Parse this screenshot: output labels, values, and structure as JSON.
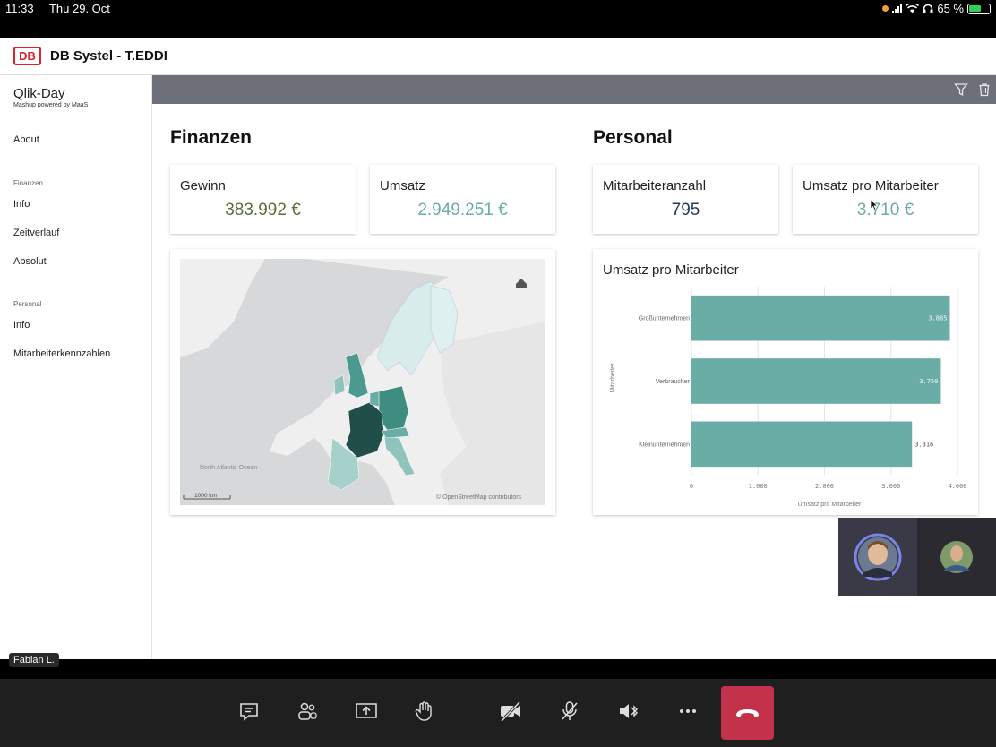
{
  "status_bar": {
    "time": "11:33",
    "date": "Thu 29. Oct",
    "battery": "65 %"
  },
  "header": {
    "logo": "DB",
    "title": "DB Systel - T.EDDI"
  },
  "sidebar": {
    "title": "Qlik-Day",
    "subtitle": "Mashup powered by MaaS",
    "about": "About",
    "sections": [
      {
        "label": "Finanzen",
        "items": [
          "Info",
          "Zeitverlauf",
          "Absolut"
        ]
      },
      {
        "label": "Personal",
        "items": [
          "Info",
          "Mitarbeiterkennzahlen"
        ]
      }
    ]
  },
  "finanzen": {
    "title": "Finanzen",
    "kpis": [
      {
        "label": "Gewinn",
        "value": "383.992 €",
        "color": "#5b6e3a"
      },
      {
        "label": "Umsatz",
        "value": "2.949.251 €",
        "color": "#6aada6"
      }
    ],
    "map": {
      "scale": "1000 km",
      "ocean": "North Atlantic Ocean",
      "attribution": "© OpenStreetMap contributors"
    }
  },
  "personal": {
    "title": "Personal",
    "kpis": [
      {
        "label": "Mitarbeiteranzahl",
        "value": "795",
        "color": "#1f3a5a"
      },
      {
        "label": "Umsatz pro Mitarbeiter",
        "value": "3.710 €",
        "color": "#6aada6"
      }
    ]
  },
  "chart_data": {
    "type": "bar",
    "orientation": "horizontal",
    "title": "Umsatz pro Mitarbeiter",
    "categories": [
      "Großunternehmen",
      "Verbraucher",
      "Kleinunternehmen"
    ],
    "values": [
      3885,
      3750,
      3316
    ],
    "value_labels": [
      "3.885",
      "3.750",
      "3.316"
    ],
    "xlabel": "Umsatz pro Mitarbeiter",
    "ylabel": "Mitarbeiter",
    "xlim": [
      0,
      4000
    ],
    "ticks": [
      0,
      1000,
      2000,
      3000,
      4000
    ],
    "tick_labels": [
      "0",
      "1.000",
      "2.000",
      "3.000",
      "4.000"
    ],
    "grid": true,
    "color": "#6aada6"
  },
  "call": {
    "participant_label": "Fabian L."
  }
}
